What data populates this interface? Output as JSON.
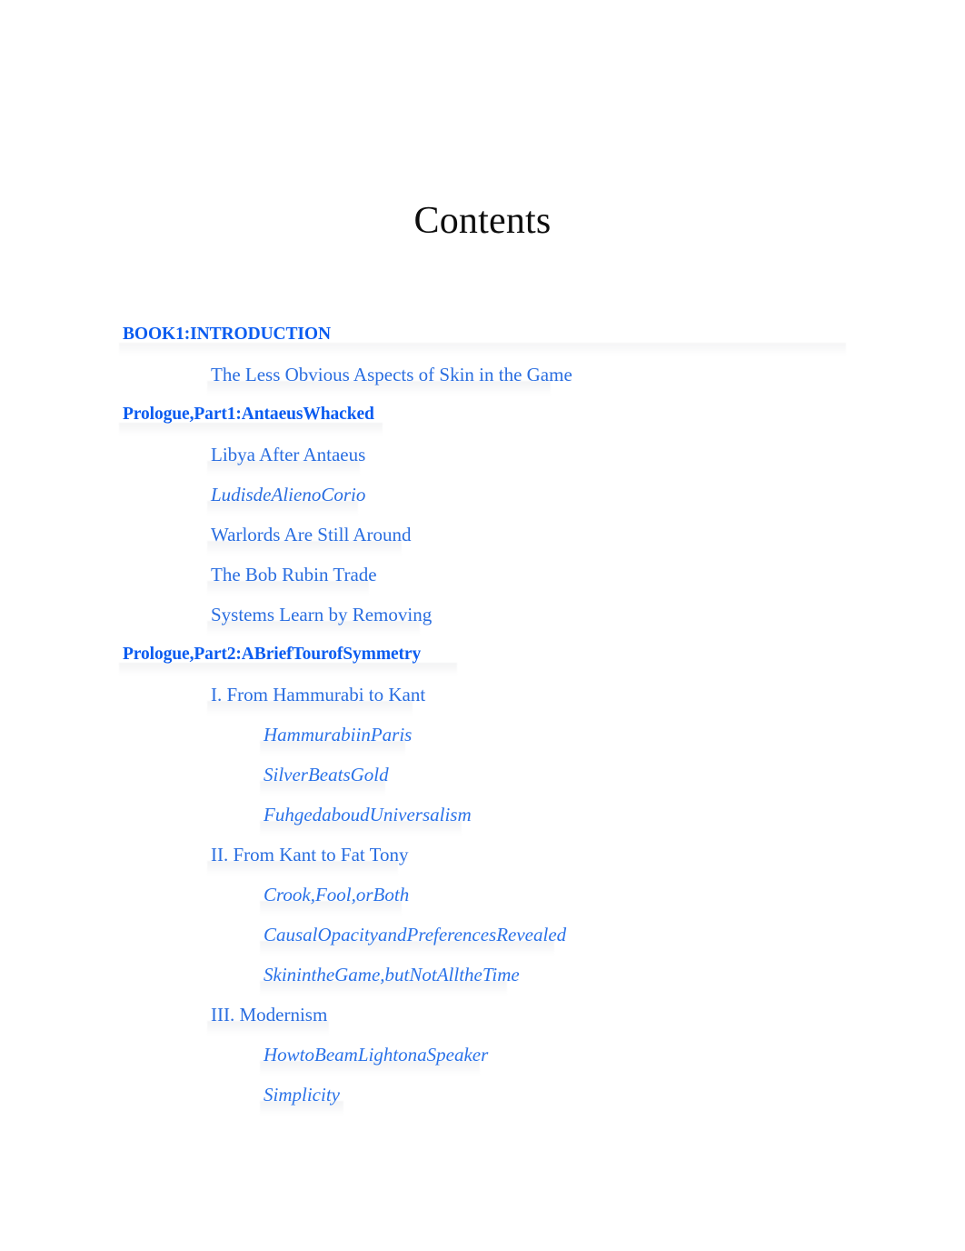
{
  "page": {
    "title": "Contents",
    "background_color": "#ffffff",
    "title_color": "#0d0d0d",
    "heading_color": "#0b5cf0",
    "entry_color": "#2a6ee0",
    "subentry_color": "#2a72e8"
  },
  "toc": {
    "entries": [
      {
        "label": "BOOK1:INTRODUCTION",
        "level": "heading",
        "style": "bold",
        "band_width": 800
      },
      {
        "label": "The Less Obvious Aspects of Skin in the Game",
        "level": "1",
        "style": "roman",
        "band_width": 378
      },
      {
        "label": "Prologue,Part1:AntaeusWhacked",
        "level": "heading",
        "style": "bold",
        "band_width": 290
      },
      {
        "label": "Libya After Antaeus",
        "level": "1",
        "style": "roman",
        "band_width": 168
      },
      {
        "label": "LudisdeAlienoCorio",
        "level": "1",
        "style": "italic",
        "band_width": 166
      },
      {
        "label": "Warlords Are Still Around",
        "level": "1",
        "style": "roman",
        "band_width": 214
      },
      {
        "label": "The Bob Rubin Trade",
        "level": "1",
        "style": "roman",
        "band_width": 178
      },
      {
        "label": "Systems Learn by Removing",
        "level": "1",
        "style": "roman",
        "band_width": 234
      },
      {
        "label": "Prologue,Part2:ABriefTourofSymmetry",
        "level": "heading",
        "style": "bold",
        "band_width": 372
      },
      {
        "label": "I. From Hammurabi to Kant",
        "level": "1",
        "style": "roman",
        "band_width": 226
      },
      {
        "label": "HammurabiinParis",
        "level": "2",
        "style": "italic",
        "band_width": 160
      },
      {
        "label": "SilverBeatsGold",
        "level": "2",
        "style": "italic",
        "band_width": 138
      },
      {
        "label": "FuhgedaboudUniversalism",
        "level": "2",
        "style": "italic",
        "band_width": 222
      },
      {
        "label": "II. From Kant to Fat Tony",
        "level": "1",
        "style": "roman",
        "band_width": 210
      },
      {
        "label": "Crook,Fool,orBoth",
        "level": "2",
        "style": "italic",
        "band_width": 156
      },
      {
        "label": "CausalOpacityandPreferencesRevealed",
        "level": "2",
        "style": "italic",
        "band_width": 324
      },
      {
        "label": "SkinintheGame,butNotAlltheTime",
        "level": "2",
        "style": "italic",
        "band_width": 272
      },
      {
        "label": "III. Modernism",
        "level": "1",
        "style": "roman",
        "band_width": 134
      },
      {
        "label": "HowtoBeamLightonaSpeaker",
        "level": "2",
        "style": "italic",
        "band_width": 242
      },
      {
        "label": "Simplicity",
        "level": "2",
        "style": "italic",
        "band_width": 92
      }
    ]
  }
}
